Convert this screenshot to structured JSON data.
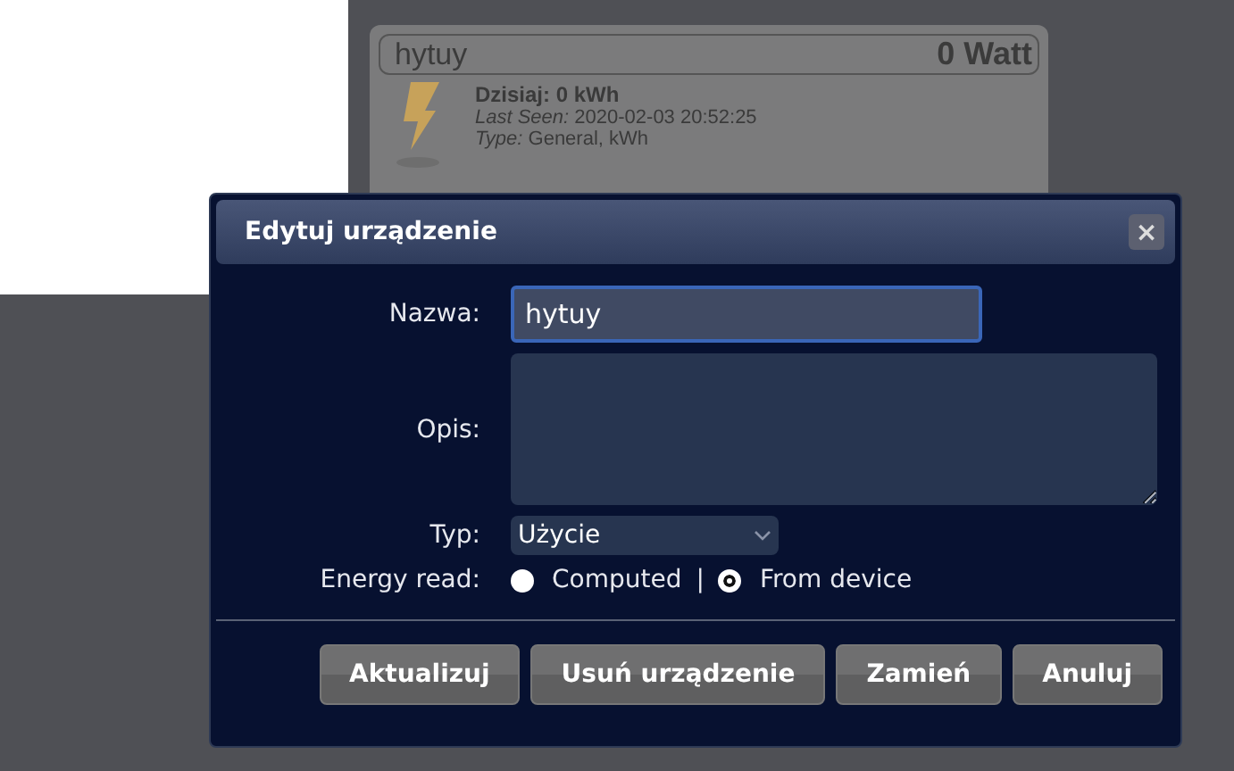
{
  "device_card": {
    "name": "hytuy",
    "power": "0 Watt",
    "today": "Dzisiaj: 0 kWh",
    "last_seen_label": "Last Seen:",
    "last_seen": "2020-02-03 20:52:25",
    "type_label": "Type:",
    "type": "General, kWh"
  },
  "dialog": {
    "title": "Edytuj urządzenie",
    "close": "×",
    "fields": [
      {
        "kind": "input",
        "label": "Nazwa:",
        "value": "hytuy"
      },
      {
        "kind": "textarea",
        "label": "Opis:"
      },
      {
        "kind": "select",
        "label": "Typ:",
        "value": "Użycie"
      },
      {
        "kind": "radio",
        "label": "Energy read:",
        "separator": "|",
        "options": [
          {
            "label": "Computed",
            "selected": false
          },
          {
            "label": "From device",
            "selected": true
          }
        ]
      }
    ],
    "buttons": [
      "Aktualizuj",
      "Usuń urządzenie",
      "Zamień",
      "Anuluj"
    ]
  }
}
